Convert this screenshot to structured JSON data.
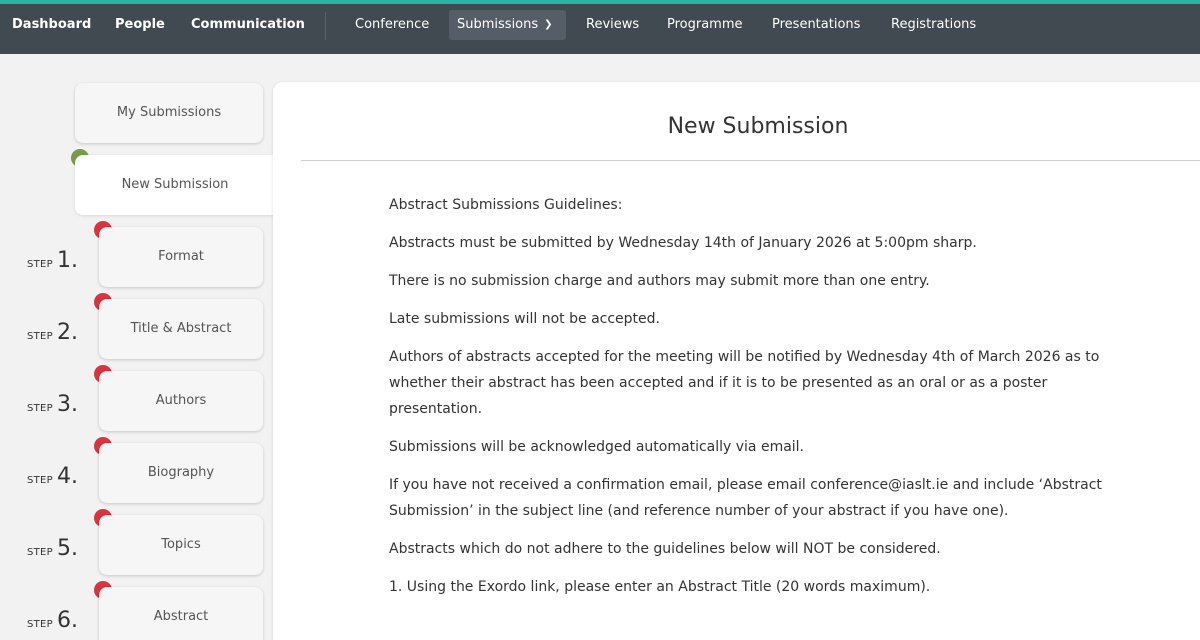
{
  "nav": {
    "left": [
      "Dashboard",
      "People",
      "Communication"
    ],
    "right": [
      "Conference",
      "Submissions",
      "Reviews",
      "Programme",
      "Presentations",
      "Registrations"
    ],
    "active": "Submissions"
  },
  "sidebar": {
    "my_submissions": "My Submissions",
    "new_submission": "New Submission",
    "step_word": "STEP",
    "steps": [
      {
        "num": "1.",
        "label": "Format"
      },
      {
        "num": "2.",
        "label": "Title & Abstract"
      },
      {
        "num": "3.",
        "label": "Authors"
      },
      {
        "num": "4.",
        "label": "Biography"
      },
      {
        "num": "5.",
        "label": "Topics"
      },
      {
        "num": "6.",
        "label": "Abstract"
      }
    ]
  },
  "main": {
    "title": "New Submission",
    "paragraphs": [
      "Abstract Submissions Guidelines:",
      "Abstracts must be submitted by Wednesday 14th of January 2026 at 5:00pm sharp.",
      "There is no submission charge and authors may submit more than one entry.",
      "Late submissions will not be accepted.",
      "Authors of abstracts accepted for the meeting will be notified by Wednesday 4th of March 2026 as to whether their abstract has been accepted and if it is to be presented as an oral or as a poster presentation.",
      "Submissions will be acknowledged automatically via email.",
      "If you have not received a confirmation email, please email conference@iaslt.ie and include ‘Abstract Submission’ in the subject line (and reference number of your abstract if you have one).",
      "Abstracts which do not adhere to the guidelines below will NOT be considered.",
      "1. Using the Exordo link, please enter an Abstract Title (20 words maximum)."
    ]
  },
  "colors": {
    "nav_bg": "#414a51",
    "accent_top": "#2bb3a3",
    "step_incomplete": "#d9343f",
    "step_current": "#7a9a48"
  }
}
